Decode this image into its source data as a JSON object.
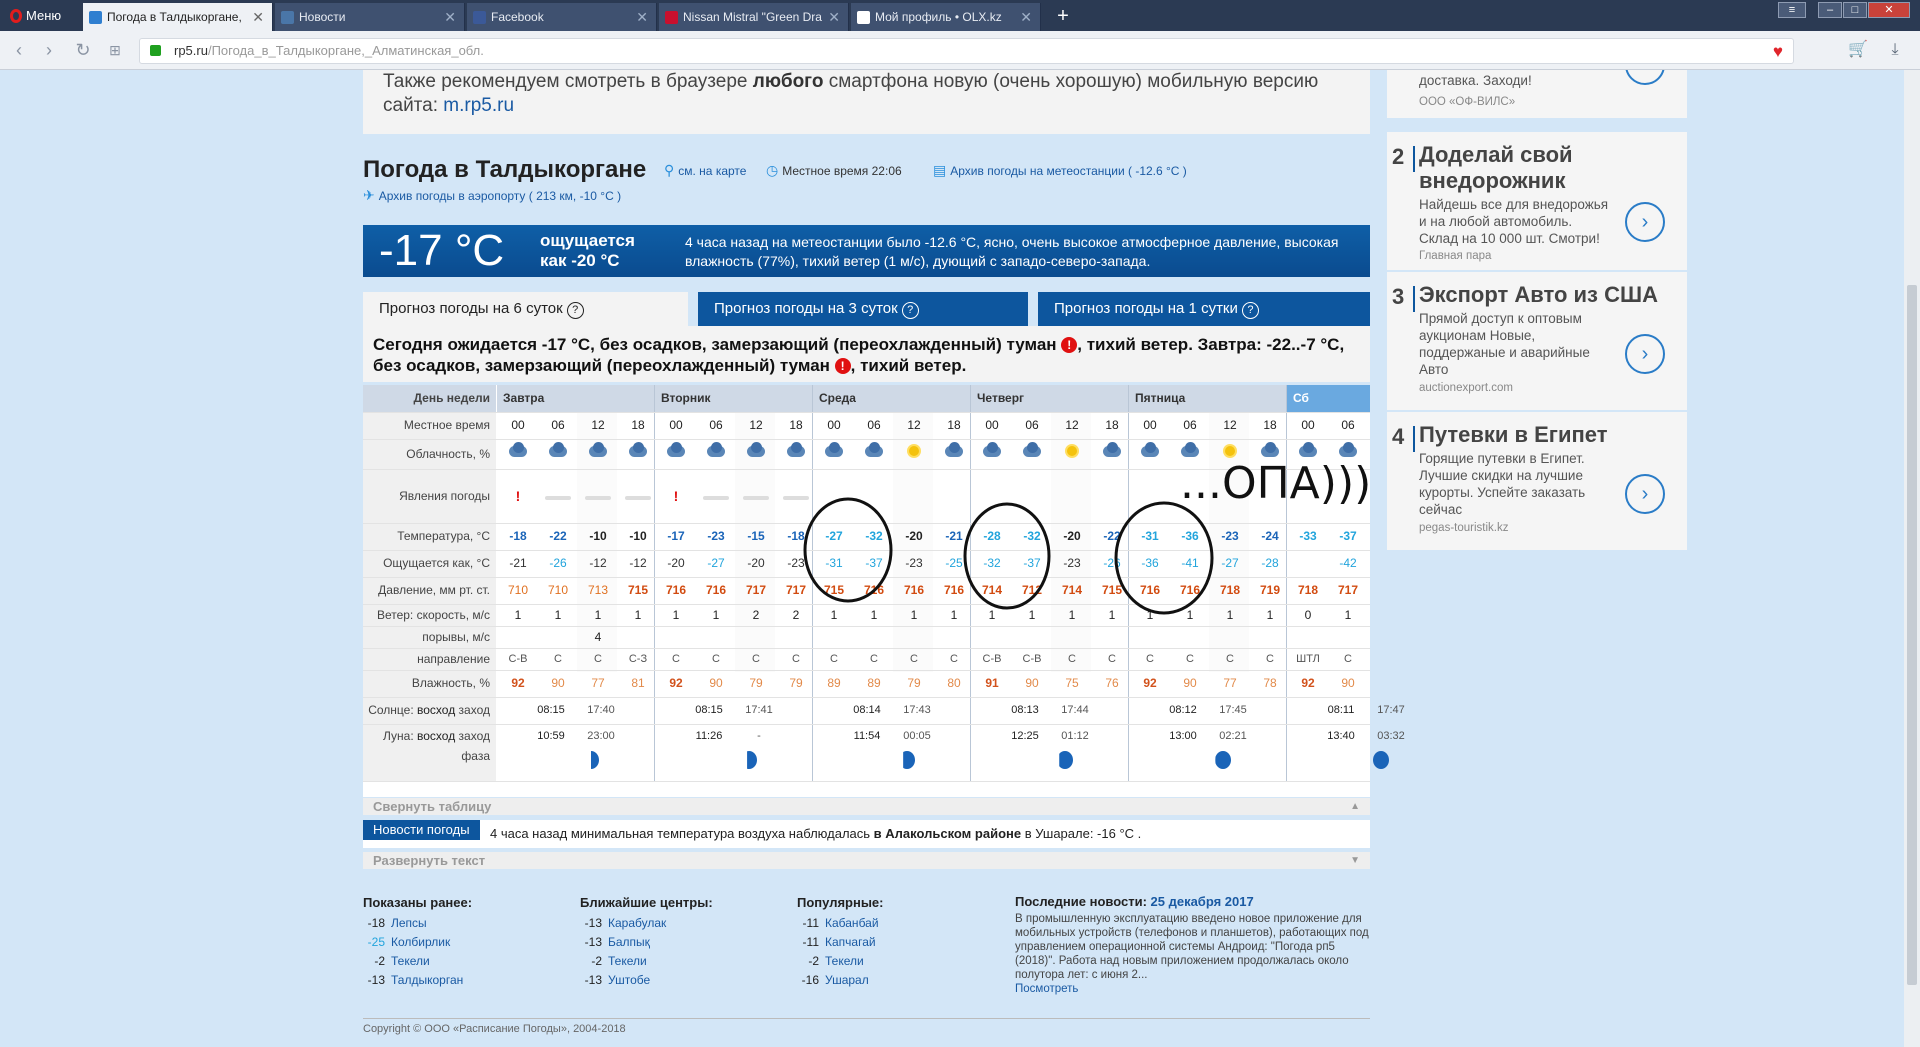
{
  "browser": {
    "menu_label": "Меню",
    "tabs": [
      {
        "label": "Погода в Талдыкоргане,",
        "active": true,
        "favicon_color": "#2f7fd0"
      },
      {
        "label": "Новости",
        "active": false,
        "favicon_color": "#4a76a8"
      },
      {
        "label": "Facebook",
        "active": false,
        "favicon_color": "#3b5998"
      },
      {
        "label": "Nissan Mistral \"Green Dra",
        "active": false,
        "favicon_color": "#c8102e"
      },
      {
        "label": "Мой профиль • OLX.kz",
        "active": false,
        "favicon_color": "#ffffff"
      }
    ],
    "url_host": "rp5.ru",
    "url_path": "/Погода_в_Талдыкоргане,_Алматинская_обл."
  },
  "page": {
    "recommend_pre": "Также рекомендуем смотреть в браузере ",
    "recommend_bold": "любого",
    "recommend_post": " смартфона новую (очень хорошую) мобильную версию",
    "recommend_line2": "сайта: ",
    "recommend_link": "m.rp5.ru",
    "title": "Погода в Талдыкоргане",
    "map_link": "см. на карте",
    "local_time": "Местное время  22:06",
    "archive_station": "Архив погоды на метеостанции ( -12.6 °C )",
    "archive_airport": "Архив погоды в аэропорту ( 213 км, -10 °C )",
    "current_temp": "-17 °C",
    "feels_like": "ощущается как -20 °C",
    "current_desc": "4 часа назад на метеостанции было -12.6 °C, ясно, очень высокое атмосферное давление, высокая влажность (77%), тихий ветер (1 м/с), дующий с западо-северо-запада.",
    "forecast_tabs": [
      "Прогноз погоды на 6 суток",
      "Прогноз погоды на 3 суток",
      "Прогноз погоды на 1 сутки"
    ],
    "summary_1": "Сегодня ожидается -17 °C, без осадков, замерзающий (переохлажденный) туман ",
    "summary_2": ", тихий ветер. Завтра: -22..-7 °C, без осадков, замерзающий (переохлажденный) туман ",
    "summary_3": ", тихий ветер.",
    "warn_symbol": "!"
  },
  "forecast": {
    "row_labels": {
      "day": "День недели",
      "time": "Местное время",
      "cloud": "Облачность, %",
      "phen": "Явления погоды",
      "temp": "Температура, °C",
      "feels": "Ощущается как, °C",
      "press": "Давление, мм рт. ст.",
      "wind": "Ветер: скорость, м/с",
      "gusts": "порывы, м/с",
      "dir": "направление",
      "hum": "Влажность, %",
      "sun_a": "Солнце: ",
      "sun_b": "восход",
      "sun_c": " заход",
      "moon_a": "Луна: ",
      "moon_b": "восход",
      "moon_c": " заход",
      "phase": "фаза"
    },
    "days": [
      "Завтра",
      "Вторник",
      "Среда",
      "Четверг",
      "Пятница",
      "Сб"
    ],
    "hours": [
      "00",
      "06",
      "12",
      "18",
      "00",
      "06",
      "12",
      "18",
      "00",
      "06",
      "12",
      "18",
      "00",
      "06",
      "12",
      "18",
      "00",
      "06",
      "12",
      "18",
      "00",
      "06"
    ],
    "cloud": [
      "cloud",
      "cloud",
      "cloud",
      "cloud",
      "cloud",
      "cloud",
      "cloud",
      "cloud",
      "cloud",
      "cloud",
      "sun",
      "cloud",
      "cloud",
      "cloud",
      "sun",
      "cloud",
      "cloud",
      "cloud",
      "sun",
      "cloud",
      "cloud",
      "cloud"
    ],
    "phen": [
      "alert",
      "fog",
      "fog",
      "fog",
      "alert",
      "fog",
      "fog",
      "fog",
      "",
      "",
      "",
      "",
      "",
      "",
      "",
      "",
      "",
      "",
      "",
      "",
      "",
      ""
    ],
    "temp": [
      "-18",
      "-22",
      "-10",
      "-10",
      "-17",
      "-23",
      "-15",
      "-18",
      "-27",
      "-32",
      "-20",
      "-21",
      "-28",
      "-32",
      "-20",
      "-22",
      "-31",
      "-36",
      "-23",
      "-24",
      "-33",
      "-37"
    ],
    "temp_cls": [
      "t-b",
      "t-b",
      "t-k",
      "t-k",
      "t-b",
      "t-b",
      "t-b",
      "t-b",
      "t-c",
      "t-c",
      "t-k",
      "t-b",
      "t-c",
      "t-c",
      "t-k",
      "t-b",
      "t-c",
      "t-c",
      "t-b",
      "t-b",
      "t-c",
      "t-c"
    ],
    "feels": [
      "-21",
      "-26",
      "-12",
      "-12",
      "-20",
      "-27",
      "-20",
      "-23",
      "-31",
      "-37",
      "-23",
      "-25",
      "-32",
      "-37",
      "-23",
      "-26",
      "-36",
      "-41",
      "-27",
      "-28",
      "",
      "-42"
    ],
    "feels_cls": [
      "f-k",
      "f-c",
      "f-k",
      "f-k",
      "f-k",
      "f-c",
      "f-k",
      "f-k",
      "f-c",
      "f-c",
      "f-k",
      "f-c",
      "f-c",
      "f-c",
      "f-k",
      "f-c",
      "f-c",
      "f-c",
      "f-c",
      "f-c",
      "f-c",
      "f-c"
    ],
    "press": [
      "710",
      "710",
      "713",
      "715",
      "716",
      "716",
      "717",
      "717",
      "715",
      "716",
      "716",
      "716",
      "714",
      "712",
      "714",
      "715",
      "716",
      "716",
      "718",
      "719",
      "718",
      "717"
    ],
    "press_cls": [
      "p-o",
      "p-o",
      "p-o",
      "p-r",
      "p-r",
      "p-r",
      "p-r",
      "p-r",
      "p-r",
      "p-r",
      "p-r",
      "p-r",
      "p-r",
      "p-r",
      "p-r",
      "p-r",
      "p-r",
      "p-r",
      "p-r",
      "p-r",
      "p-r",
      "p-r"
    ],
    "wind": [
      "1",
      "1",
      "1",
      "1",
      "1",
      "1",
      "2",
      "2",
      "1",
      "1",
      "1",
      "1",
      "1",
      "1",
      "1",
      "1",
      "1",
      "1",
      "1",
      "1",
      "0",
      "1"
    ],
    "gusts": [
      "",
      "",
      "4",
      "",
      "",
      "",
      "",
      "",
      "",
      "",
      "",
      "",
      "",
      "",
      "",
      "",
      "",
      "",
      "",
      "",
      "",
      ""
    ],
    "dir": [
      "С-В",
      "С",
      "С",
      "С-З",
      "С",
      "С",
      "С",
      "С",
      "С",
      "С",
      "С",
      "С",
      "С-В",
      "С-В",
      "С",
      "С",
      "С",
      "С",
      "С",
      "С",
      "ШТЛ",
      "С"
    ],
    "hum": [
      "92",
      "90",
      "77",
      "81",
      "92",
      "90",
      "79",
      "79",
      "89",
      "89",
      "79",
      "80",
      "91",
      "90",
      "75",
      "76",
      "92",
      "90",
      "77",
      "78",
      "92",
      "90"
    ],
    "hum_cls": [
      "h-r",
      "h-o",
      "h-o",
      "h-o",
      "h-r",
      "h-o",
      "h-o",
      "h-o",
      "h-o",
      "h-o",
      "h-o",
      "h-o",
      "h-r",
      "h-o",
      "h-o",
      "h-o",
      "h-r",
      "h-o",
      "h-o",
      "h-o",
      "h-r",
      "h-o"
    ],
    "sun": [
      [
        "08:15",
        "17:40"
      ],
      [
        "08:15",
        "17:41"
      ],
      [
        "08:14",
        "17:43"
      ],
      [
        "08:13",
        "17:44"
      ],
      [
        "08:12",
        "17:45"
      ],
      [
        "08:11",
        "17:47"
      ]
    ],
    "moon": [
      [
        "10:59",
        "23:00"
      ],
      [
        "11:26",
        "-"
      ],
      [
        "11:54",
        "00:05"
      ],
      [
        "12:25",
        "01:12"
      ],
      [
        "13:00",
        "02:21"
      ],
      [
        "13:40",
        "03:32"
      ]
    ],
    "collapse": "Свернуть таблицу"
  },
  "news": {
    "tag": "Новости погоды",
    "text_pre": "4 часа назад минимальная температура воздуха наблюдалась ",
    "text_bold": "в Алакольском районе",
    "text_post": " в Ушарале: -16 °C .",
    "expand": "Развернуть текст"
  },
  "lists": {
    "shown": {
      "title": "Показаны ранее:",
      "items": [
        [
          "-18",
          "Лепсы"
        ],
        [
          "-25",
          "Колбирлик"
        ],
        [
          "-2",
          "Текели"
        ],
        [
          "-13",
          "Талдыкорган"
        ]
      ]
    },
    "nearest": {
      "title": "Ближайшие центры:",
      "items": [
        [
          "-13",
          "Карабулак"
        ],
        [
          "-13",
          "Балпық"
        ],
        [
          "-2",
          "Текели"
        ],
        [
          "-13",
          "Уштобе"
        ]
      ]
    },
    "popular": {
      "title": "Популярные:",
      "items": [
        [
          "-11",
          "Кабанбай"
        ],
        [
          "-11",
          "Капчагай"
        ],
        [
          "-2",
          "Текели"
        ],
        [
          "-16",
          "Ушарал"
        ]
      ]
    }
  },
  "latest": {
    "title": "Последние новости: ",
    "date": "25 декабря 2017",
    "text": "В промышленную эксплуатацию введено новое приложение для мобильных устройств (телефонов и планшетов), работающих под управлением операционной системы Андроид: \"Погода рп5 (2018)\". Работа над новым приложением продолжалась около полутора лет: с июня 2...",
    "more": "Посмотреть"
  },
  "copyright": "Copyright © ООО «Расписание Погоды», 2004-2018",
  "ads": [
    {
      "num": "",
      "title": "",
      "text": "доставка. Заходи!",
      "src": "ООО «ОФ-ВИЛС»"
    },
    {
      "num": "2",
      "title": "Доделай свой внедорожник",
      "text": "Найдешь все для внедорожья и на любой автомобиль. Склад на 10 000 шт. Смотри!",
      "src": "Главная пара"
    },
    {
      "num": "3",
      "title": "Экспорт Авто из США",
      "text": "Прямой доступ к оптовым аукционам Новые, поддержаные и аварийные Авто",
      "src": "auctionexport.com"
    },
    {
      "num": "4",
      "title": "Путевки в Египет",
      "text": "Горящие путевки в Египет. Лучшие скидки на лучшие курорты. Успейте заказать сейчас",
      "src": "pegas-touristik.kz"
    }
  ],
  "scribble_text": "...ОПА)))"
}
